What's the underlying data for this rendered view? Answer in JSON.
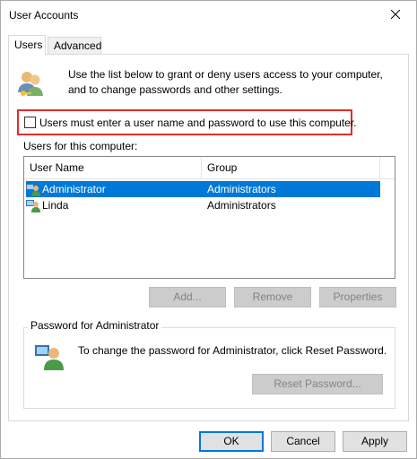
{
  "window": {
    "title": "User Accounts"
  },
  "tabs": [
    {
      "label": "Users",
      "active": true
    },
    {
      "label": "Advanced",
      "active": false
    }
  ],
  "intro": {
    "text": "Use the list below to grant or deny users access to your computer, and to change passwords and other settings.",
    "icon": "users-icon"
  },
  "checkbox": {
    "label": "Users must enter a user name and password to use this computer.",
    "checked": false,
    "highlight_color": "#e12c2c"
  },
  "users_list": {
    "label": "Users for this computer:",
    "columns": [
      "User Name",
      "Group"
    ],
    "rows": [
      {
        "name": "Administrator",
        "group": "Administrators",
        "selected": true
      },
      {
        "name": "Linda",
        "group": "Administrators",
        "selected": false
      }
    ]
  },
  "list_buttons": {
    "add": "Add...",
    "remove": "Remove",
    "properties": "Properties"
  },
  "password_group": {
    "title": "Password for Administrator",
    "text": "To change the password for Administrator, click Reset Password.",
    "reset_button": "Reset Password...",
    "icon": "user-key-icon"
  },
  "dialog_buttons": {
    "ok": "OK",
    "cancel": "Cancel",
    "apply": "Apply"
  },
  "colors": {
    "selection": "#0078d7",
    "highlight": "#e12c2c"
  }
}
